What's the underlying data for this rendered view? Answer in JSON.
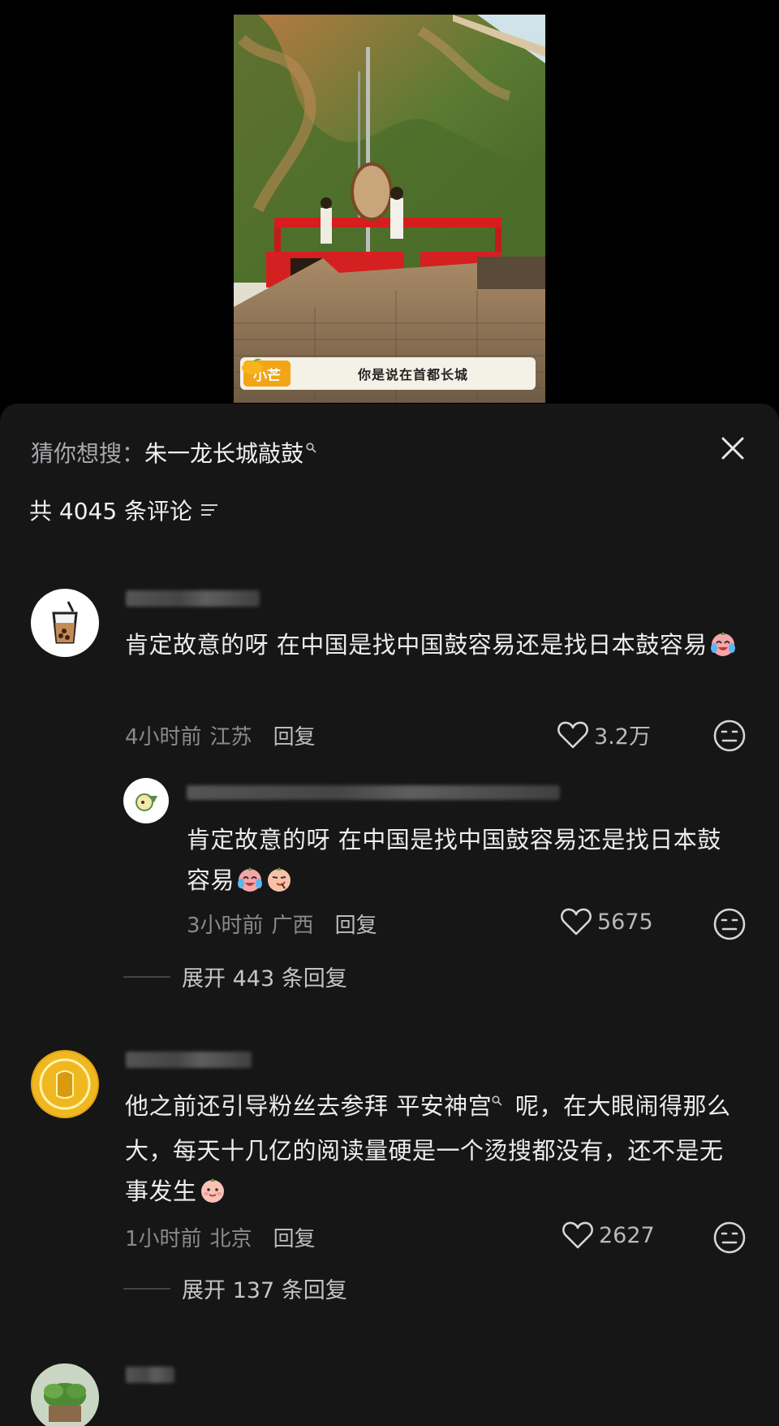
{
  "video": {
    "subtitle_tag": "小芒",
    "subtitle_text": "你是说在首都长城"
  },
  "panel": {
    "suggest_prefix": "猜你想搜：",
    "suggest_term": "朱一龙长城敲鼓",
    "suggest_icon": "search-icon",
    "close_icon": "close-icon",
    "count_text": "共 4045 条评论",
    "sort_icon": "sort-icon"
  },
  "comments": [
    {
      "text": "肯定故意的呀 在中国是找中国鼓容易还是找日本鼓容易",
      "emoji": "crying-laughing-emoji",
      "time": "4小时前",
      "location": "江苏",
      "reply_label": "回复",
      "likes": "3.2万",
      "reply": {
        "text": "肯定故意的呀 在中国是找中国鼓容易还是找日本鼓容易",
        "emojis": [
          "crying-laughing-emoji",
          "peach-smirk-emoji"
        ],
        "time": "3小时前",
        "location": "广西",
        "reply_label": "回复",
        "likes": "5675"
      },
      "expand_label": "展开 443 条回复"
    },
    {
      "text_part1": "他之前还引导粉丝去参拜 ",
      "link": "平安神宫",
      "text_part2": " 呢，在大眼闹得那么大，每天十几亿的阅读量硬是一个烫搜都没有，还不是无事发生",
      "emoji": "peach-smile-emoji",
      "time": "1小时前",
      "location": "北京",
      "reply_label": "回复",
      "likes": "2627",
      "expand_label": "展开 137 条回复"
    }
  ],
  "colors": {
    "panel_bg": "#161617",
    "accent_orange": "#f2a516"
  }
}
